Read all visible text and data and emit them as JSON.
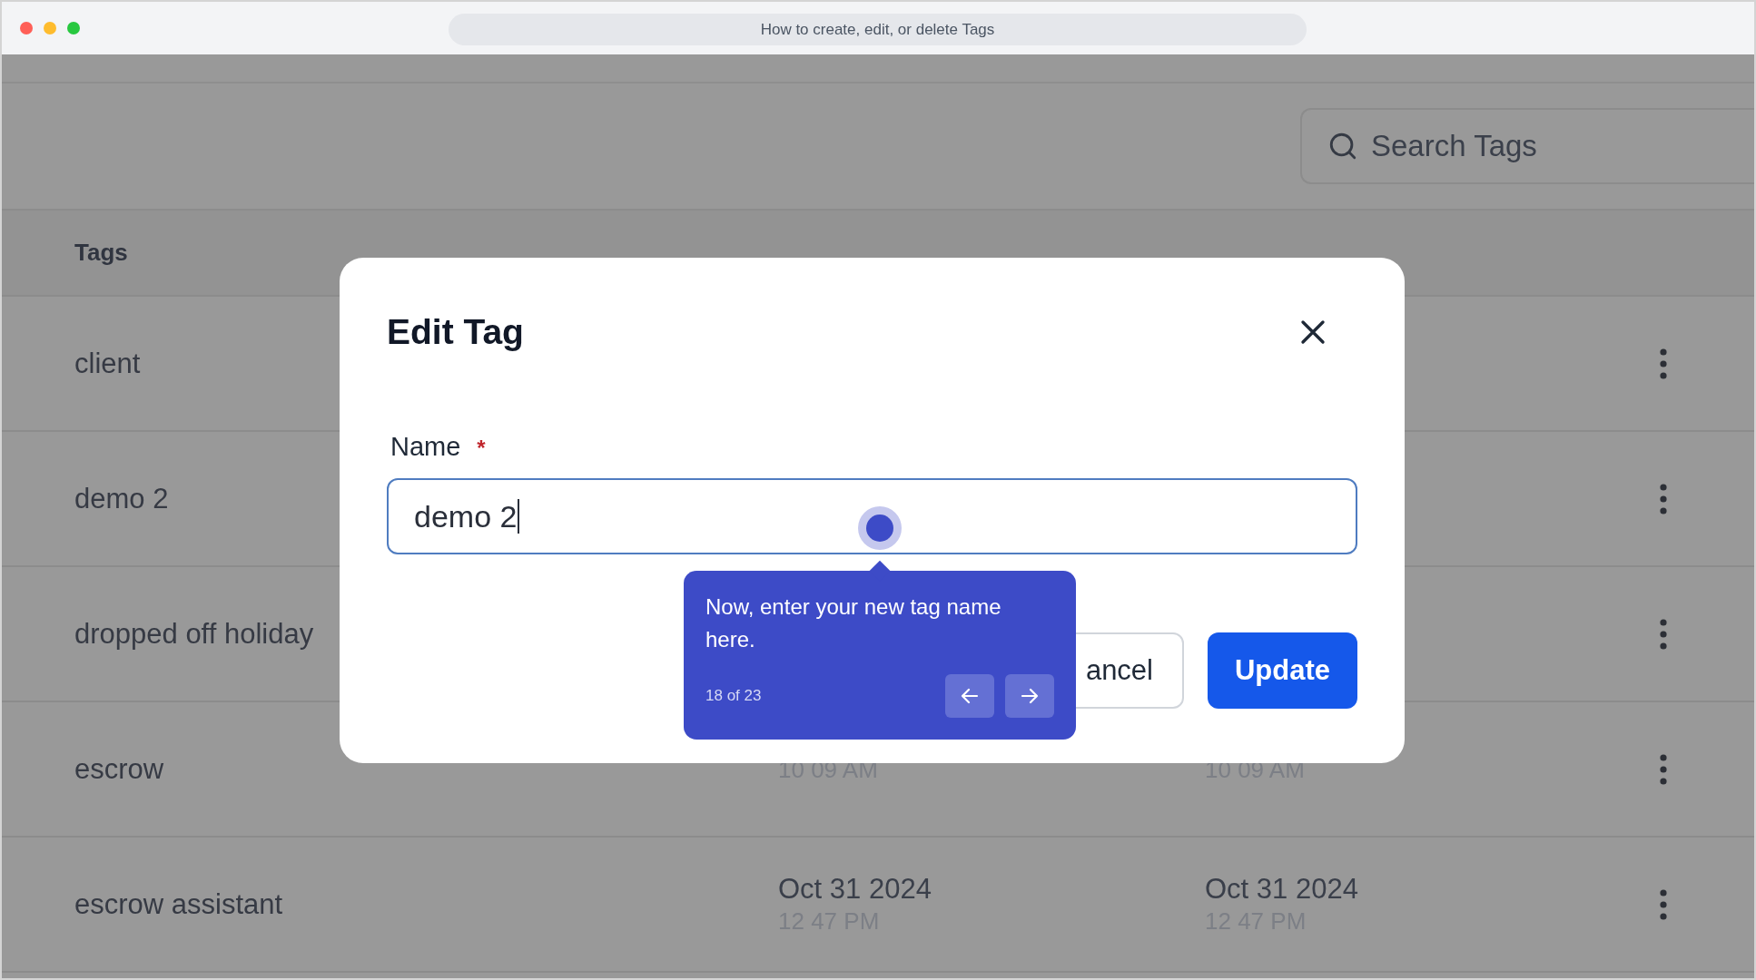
{
  "window": {
    "title": "How to create, edit, or delete Tags"
  },
  "search": {
    "placeholder": "Search Tags"
  },
  "table": {
    "columns": [
      "Tags"
    ],
    "rows": [
      {
        "name": "client"
      },
      {
        "name": "demo 2"
      },
      {
        "name": "dropped off holiday"
      },
      {
        "name": "escrow",
        "created": {
          "time": "10 09 AM"
        },
        "updated": {
          "time": "10 09 AM"
        }
      },
      {
        "name": "escrow assistant",
        "created": {
          "date": "Oct 31 2024",
          "time": "12 47 PM"
        },
        "updated": {
          "date": "Oct 31 2024",
          "time": "12 47 PM"
        }
      }
    ]
  },
  "modal": {
    "title": "Edit Tag",
    "field": {
      "label": "Name",
      "required_mark": "*",
      "value": "demo 2"
    },
    "buttons": [
      {
        "label": "ancel",
        "kind": "secondary"
      },
      {
        "label": "Update",
        "kind": "primary"
      }
    ]
  },
  "tour_tip": {
    "text": "Now, enter your new tag name here.",
    "progress": "18 of 23"
  }
}
